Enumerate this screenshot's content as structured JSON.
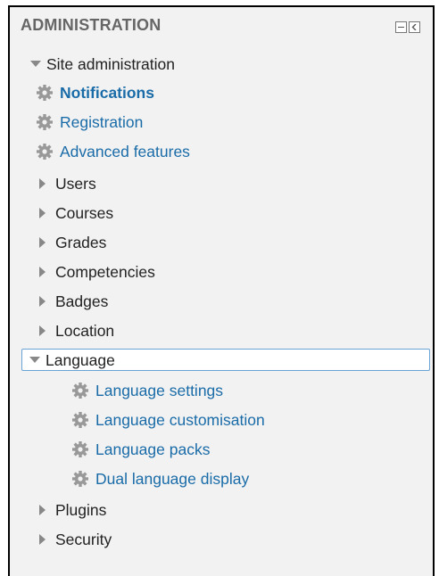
{
  "block": {
    "title": "ADMINISTRATION",
    "controls": [
      "hide-icon",
      "dock-icon"
    ]
  },
  "tree": {
    "root": {
      "label": "Site administration",
      "expanded": true
    },
    "links": [
      {
        "label": "Notifications",
        "bold": true
      },
      {
        "label": "Registration",
        "bold": false
      },
      {
        "label": "Advanced features",
        "bold": false
      }
    ],
    "sections": [
      {
        "label": "Users",
        "expanded": false
      },
      {
        "label": "Courses",
        "expanded": false
      },
      {
        "label": "Grades",
        "expanded": false
      },
      {
        "label": "Competencies",
        "expanded": false
      },
      {
        "label": "Badges",
        "expanded": false
      },
      {
        "label": "Location",
        "expanded": false
      },
      {
        "label": "Language",
        "expanded": true,
        "focused": true
      },
      {
        "label": "Plugins",
        "expanded": false
      },
      {
        "label": "Security",
        "expanded": false
      }
    ],
    "language_children": [
      {
        "label": "Language settings"
      },
      {
        "label": "Language customisation"
      },
      {
        "label": "Language packs"
      },
      {
        "label": "Dual language display"
      }
    ]
  },
  "colors": {
    "link": "#1a6ca8",
    "text": "#222222",
    "header": "#666666",
    "icon": "#999999",
    "focus_border": "#6aa3d6"
  }
}
